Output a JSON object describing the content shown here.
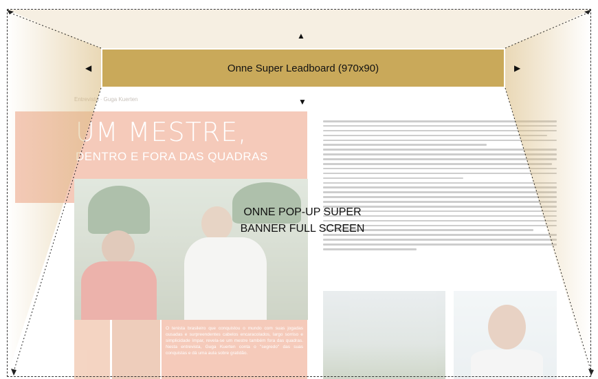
{
  "banner": {
    "leaderboard_label": "Onne Super Leadboard (970x90)",
    "popup_label_line1": "ONNE POP-UP SUPER",
    "popup_label_line2": "BANNER FULL SCREEN"
  },
  "arrows": {
    "up": "▲",
    "down": "▼",
    "left": "◀",
    "right": "▶"
  },
  "page": {
    "breadcrumb": "Entrevista · Guga Kuerten",
    "headline": "UM MESTRE,",
    "subheadline": "DENTRO E FORA DAS QUADRAS",
    "caption": "O tenista brasileiro que conquistou o mundo com suas jogadas ousadas e surpreendentes cabelos encaracolados, largo sorriso e simplicidade ímpar, revela-se um mestre também fora das quadras. Nesta entrevista, Guga Kuerten conta o \"segredo\" das suas conquistas e dá uma aula sobre gratidão."
  },
  "colors": {
    "leaderboard_bg": "#c9a95a",
    "accent_orange": "#e8825c"
  }
}
